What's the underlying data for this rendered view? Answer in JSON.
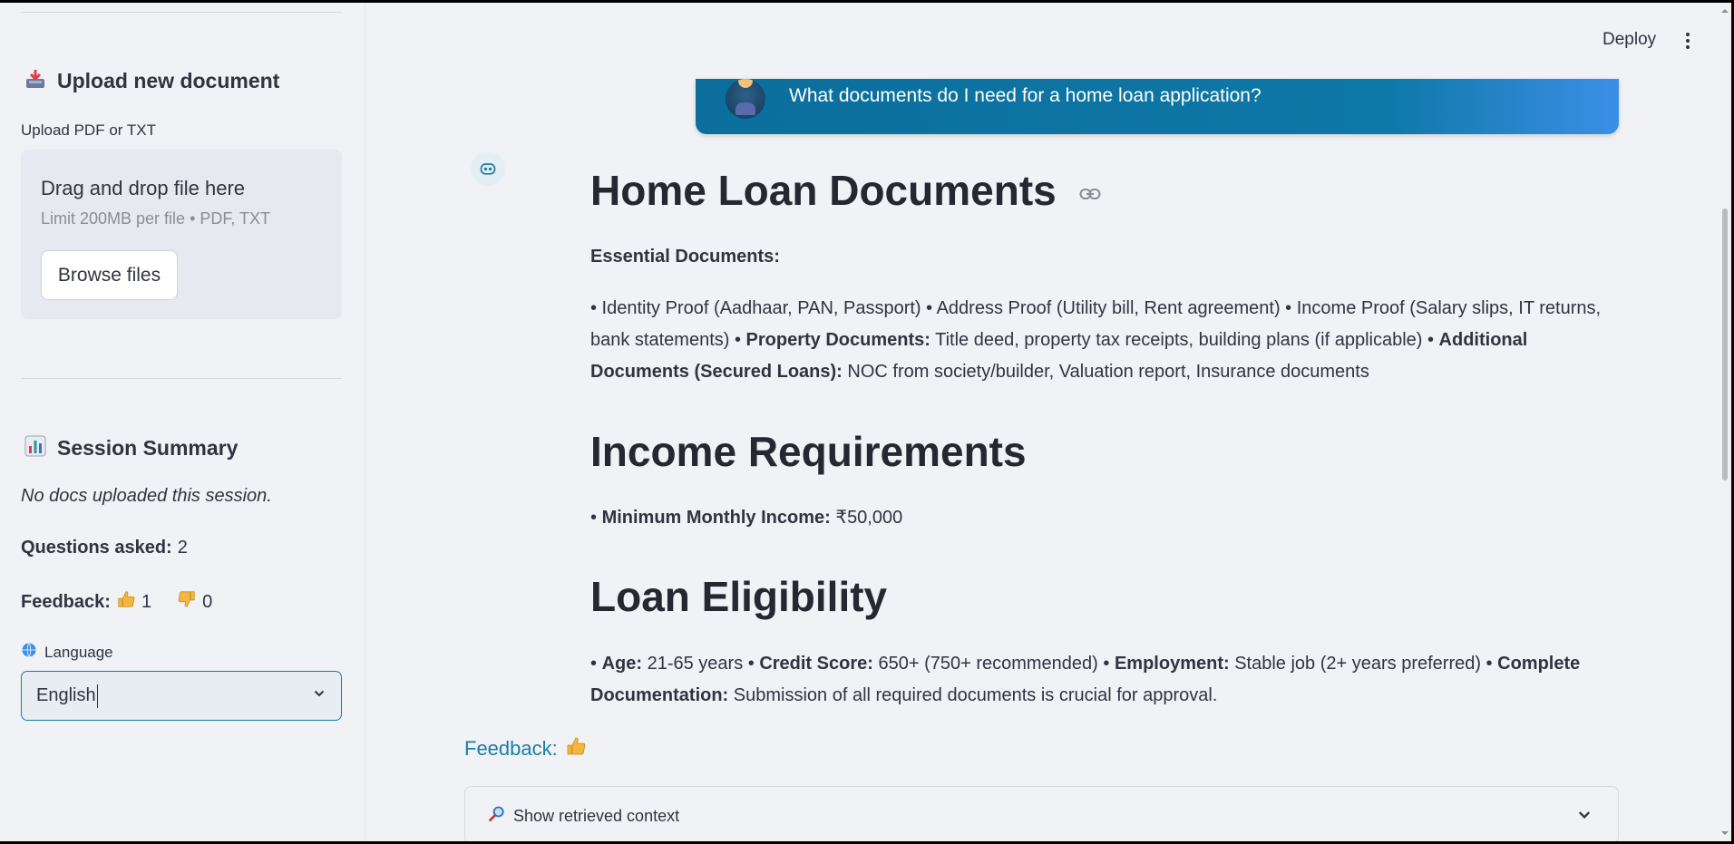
{
  "sidebar": {
    "upload_heading": "Upload new document",
    "upload_icon": "inbox-tray-icon",
    "upload_label": "Upload PDF or TXT",
    "dropzone_title": "Drag and drop file here",
    "dropzone_limit": "Limit 200MB per file • PDF, TXT",
    "browse_label": "Browse files",
    "summary_heading": "Session Summary",
    "summary_icon": "bar-chart-icon",
    "no_docs": "No docs uploaded this session.",
    "questions_label": "Questions asked:",
    "questions_value": "2",
    "feedback_label": "Feedback:",
    "thumbs_up_count": "1",
    "thumbs_down_count": "0",
    "language_label": "Language",
    "language_value": "English"
  },
  "header": {
    "deploy_label": "Deploy"
  },
  "chat": {
    "user_message": "What documents do I need for a home loan application?",
    "answer": {
      "h1": "Home Loan Documents",
      "essential_label": "Essential Documents:",
      "p1_a": "• Identity Proof (Aadhaar, PAN, Passport) • Address Proof (Utility bill, Rent agreement) • Income Proof (Salary slips, IT returns, bank statements) • ",
      "p1_b": "Property Documents:",
      "p1_c": " Title deed, property tax receipts, building plans (if applicable) • ",
      "p1_d": "Additional Documents (Secured Loans):",
      "p1_e": " NOC from society/builder, Valuation report, Insurance documents",
      "h2": "Income Requirements",
      "p2_a": "• ",
      "p2_b": "Minimum Monthly Income:",
      "p2_c": " ₹50,000",
      "h3": "Loan Eligibility",
      "p3_a": "• ",
      "p3_b": "Age:",
      "p3_c": " 21-65 years • ",
      "p3_d": "Credit Score:",
      "p3_e": " 650+ (750+ recommended) • ",
      "p3_f": "Employment:",
      "p3_g": " Stable job (2+ years preferred) • ",
      "p3_h": "Complete Documentation:",
      "p3_i": " Submission of all required documents is crucial for approval."
    },
    "feedback_label": "Feedback:",
    "expander_label": "Show retrieved context"
  },
  "colors": {
    "accent": "#1a7ea3",
    "bubble_start": "#0b6e9c",
    "bubble_end": "#3c8fe6",
    "background": "#f0f2f6"
  }
}
